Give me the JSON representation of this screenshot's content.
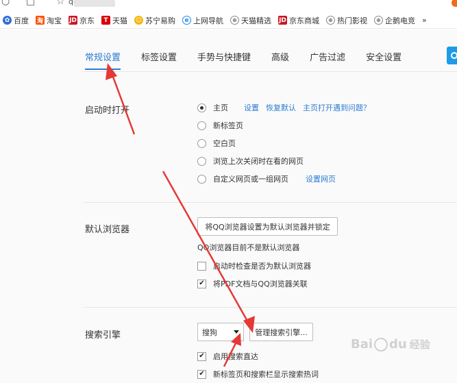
{
  "topbar": {
    "partial_url": "qq"
  },
  "bookmarks": [
    {
      "label": "百度",
      "icon": "baidu-icon",
      "cls": "baidu",
      "glyph": "✿"
    },
    {
      "label": "淘宝",
      "icon": "taobao-icon",
      "cls": "taobao",
      "glyph": "淘"
    },
    {
      "label": "京东",
      "icon": "jd-icon",
      "cls": "jd",
      "glyph": "JD"
    },
    {
      "label": "天猫",
      "icon": "tmall-icon",
      "cls": "tmall",
      "glyph": "T"
    },
    {
      "label": "苏宁易购",
      "icon": "suning-icon",
      "cls": "suning",
      "glyph": "☺"
    },
    {
      "label": "上网导航",
      "icon": "ie-icon",
      "cls": "ie",
      "glyph": "e"
    },
    {
      "label": "天猫精选",
      "icon": "globe-icon",
      "cls": "globe",
      "glyph": "⊕"
    },
    {
      "label": "京东商城",
      "icon": "jd-icon",
      "cls": "jd",
      "glyph": "JD"
    },
    {
      "label": "热门影视",
      "icon": "globe-icon",
      "cls": "globe",
      "glyph": "⊕"
    },
    {
      "label": "企鹅电竞",
      "icon": "globe-icon",
      "cls": "globe",
      "glyph": "⊕"
    }
  ],
  "bookmarks_more": "»",
  "tabs": [
    {
      "label": "常规设置",
      "active": true
    },
    {
      "label": "标签设置",
      "active": false
    },
    {
      "label": "手势与快捷键",
      "active": false
    },
    {
      "label": "高级",
      "active": false
    },
    {
      "label": "广告过滤",
      "active": false
    },
    {
      "label": "安全设置",
      "active": false
    }
  ],
  "startup": {
    "title": "启动时打开",
    "options": {
      "home": "主页",
      "new_tab": "新标签页",
      "blank": "空白页",
      "last_session": "浏览上次关闭时在看的网页",
      "custom": "自定义网页或一组网页"
    },
    "links": {
      "settings": "设置",
      "restore_default": "恢复默认",
      "home_problem": "主页打开遇到问题？",
      "set_pages": "设置网页"
    },
    "selected": "home"
  },
  "default_browser": {
    "title": "默认浏览器",
    "set_button": "将QQ浏览器设置为默认浏览器并锁定",
    "status": "QQ浏览器目前不是默认浏览器",
    "check_on_start": "启动时检查是否为默认浏览器",
    "check_on_start_checked": false,
    "pdf_assoc": "将PDF文档与QQ浏览器关联",
    "pdf_assoc_checked": true
  },
  "search": {
    "title": "搜索引擎",
    "engine": "搜狗",
    "manage_button": "管理搜索引擎...",
    "direct": "启用搜索直达",
    "direct_checked": true,
    "hot": "新标签页和搜索栏显示搜索热词",
    "hot_checked": true
  },
  "watermark": {
    "brand": "Bai",
    "brand2": "du",
    "jingyan": "经验"
  },
  "colors": {
    "accent": "#2b7cd3",
    "arrow": "#e53935"
  }
}
